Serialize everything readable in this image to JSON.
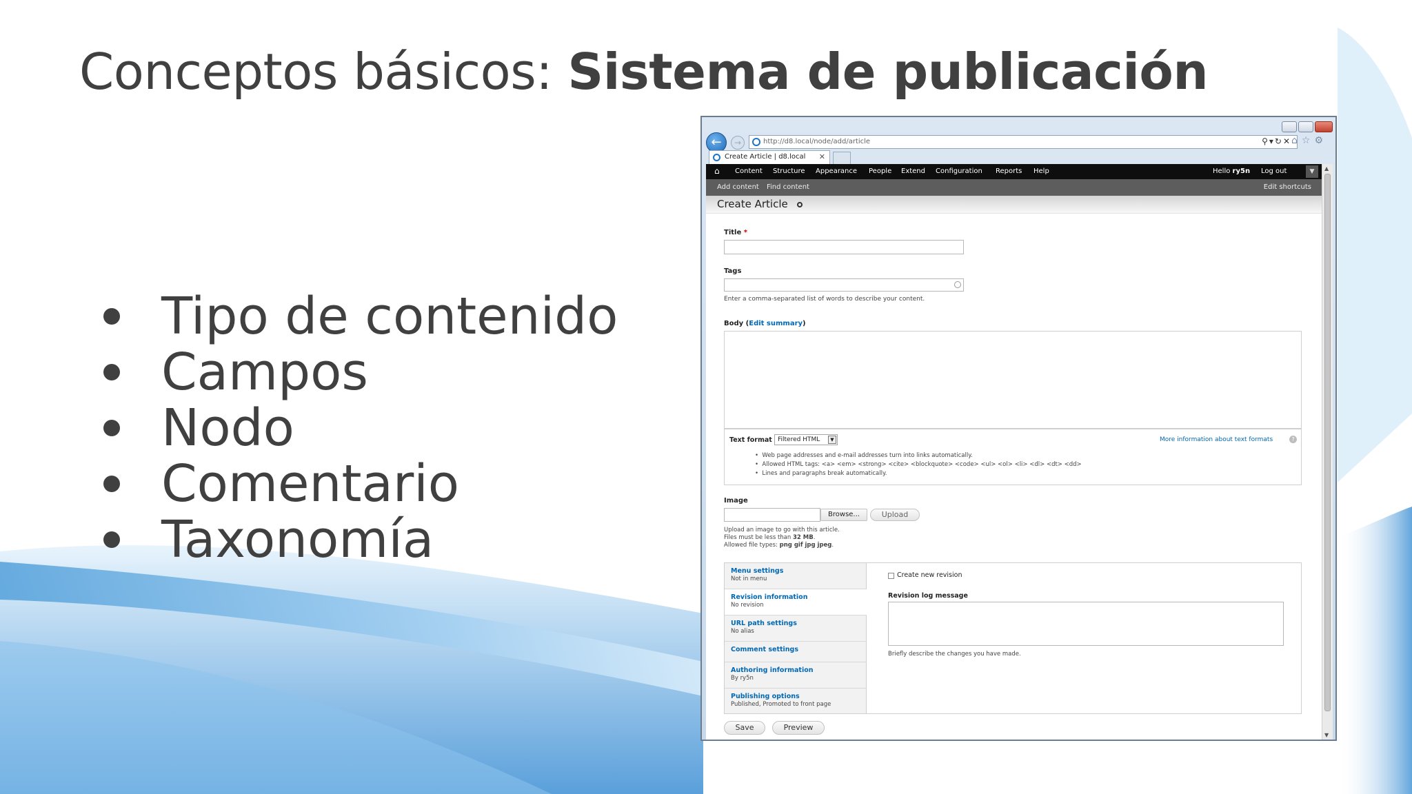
{
  "slide": {
    "title_light": "Conceptos básicos: ",
    "title_bold": "Sistema de publicación",
    "bullets": [
      "Tipo de contenido",
      "Campos",
      "Nodo",
      "Comentario",
      "Taxonomía"
    ]
  },
  "browser": {
    "url": "http://d8.local/node/add/article",
    "tab_title": "Create Article | d8.local"
  },
  "toolbar": {
    "menu": [
      "Content",
      "Structure",
      "Appearance",
      "People",
      "Extend",
      "Configuration",
      "Reports",
      "Help"
    ],
    "greeting": "Hello",
    "user": "ry5n",
    "logout": "Log out"
  },
  "shortcuts": {
    "items": [
      "Add content",
      "Find content"
    ],
    "edit": "Edit shortcuts"
  },
  "page": {
    "heading": "Create Article"
  },
  "form": {
    "title_label": "Title",
    "required_mark": "*",
    "tags_label": "Tags",
    "tags_desc": "Enter a comma-separated list of words to describe your content.",
    "body_label": "Body (",
    "body_link": "Edit summary",
    "body_label_end": ")",
    "text_format_label": "Text format",
    "text_format_value": "Filtered HTML",
    "more_info": "More information about text formats",
    "format_tips": [
      "Web page addresses and e-mail addresses turn into links automatically.",
      "Allowed HTML tags: <a> <em> <strong> <cite> <blockquote> <code> <ul> <ol> <li> <dl> <dt> <dd>",
      "Lines and paragraphs break automatically."
    ],
    "image_label": "Image",
    "browse": "Browse...",
    "upload": "Upload",
    "image_desc_1": "Upload an image to go with this article.",
    "image_desc_2_pre": "Files must be less than ",
    "image_desc_2_size": "32 MB",
    "image_desc_2_post": ".",
    "image_desc_3_pre": "Allowed file types: ",
    "image_desc_3_types": "png gif jpg jpeg",
    "image_desc_3_post": "."
  },
  "vertical_tabs": [
    {
      "title": "Menu settings",
      "summary": "Not in menu"
    },
    {
      "title": "Revision information",
      "summary": "No revision"
    },
    {
      "title": "URL path settings",
      "summary": "No alias"
    },
    {
      "title": "Comment settings",
      "summary": ""
    },
    {
      "title": "Authoring information",
      "summary": "By ry5n"
    },
    {
      "title": "Publishing options",
      "summary": "Published, Promoted to front page"
    }
  ],
  "revision": {
    "checkbox_label": "Create new revision",
    "log_label": "Revision log message",
    "log_desc": "Briefly describe the changes you have made."
  },
  "actions": {
    "save": "Save",
    "preview": "Preview"
  }
}
